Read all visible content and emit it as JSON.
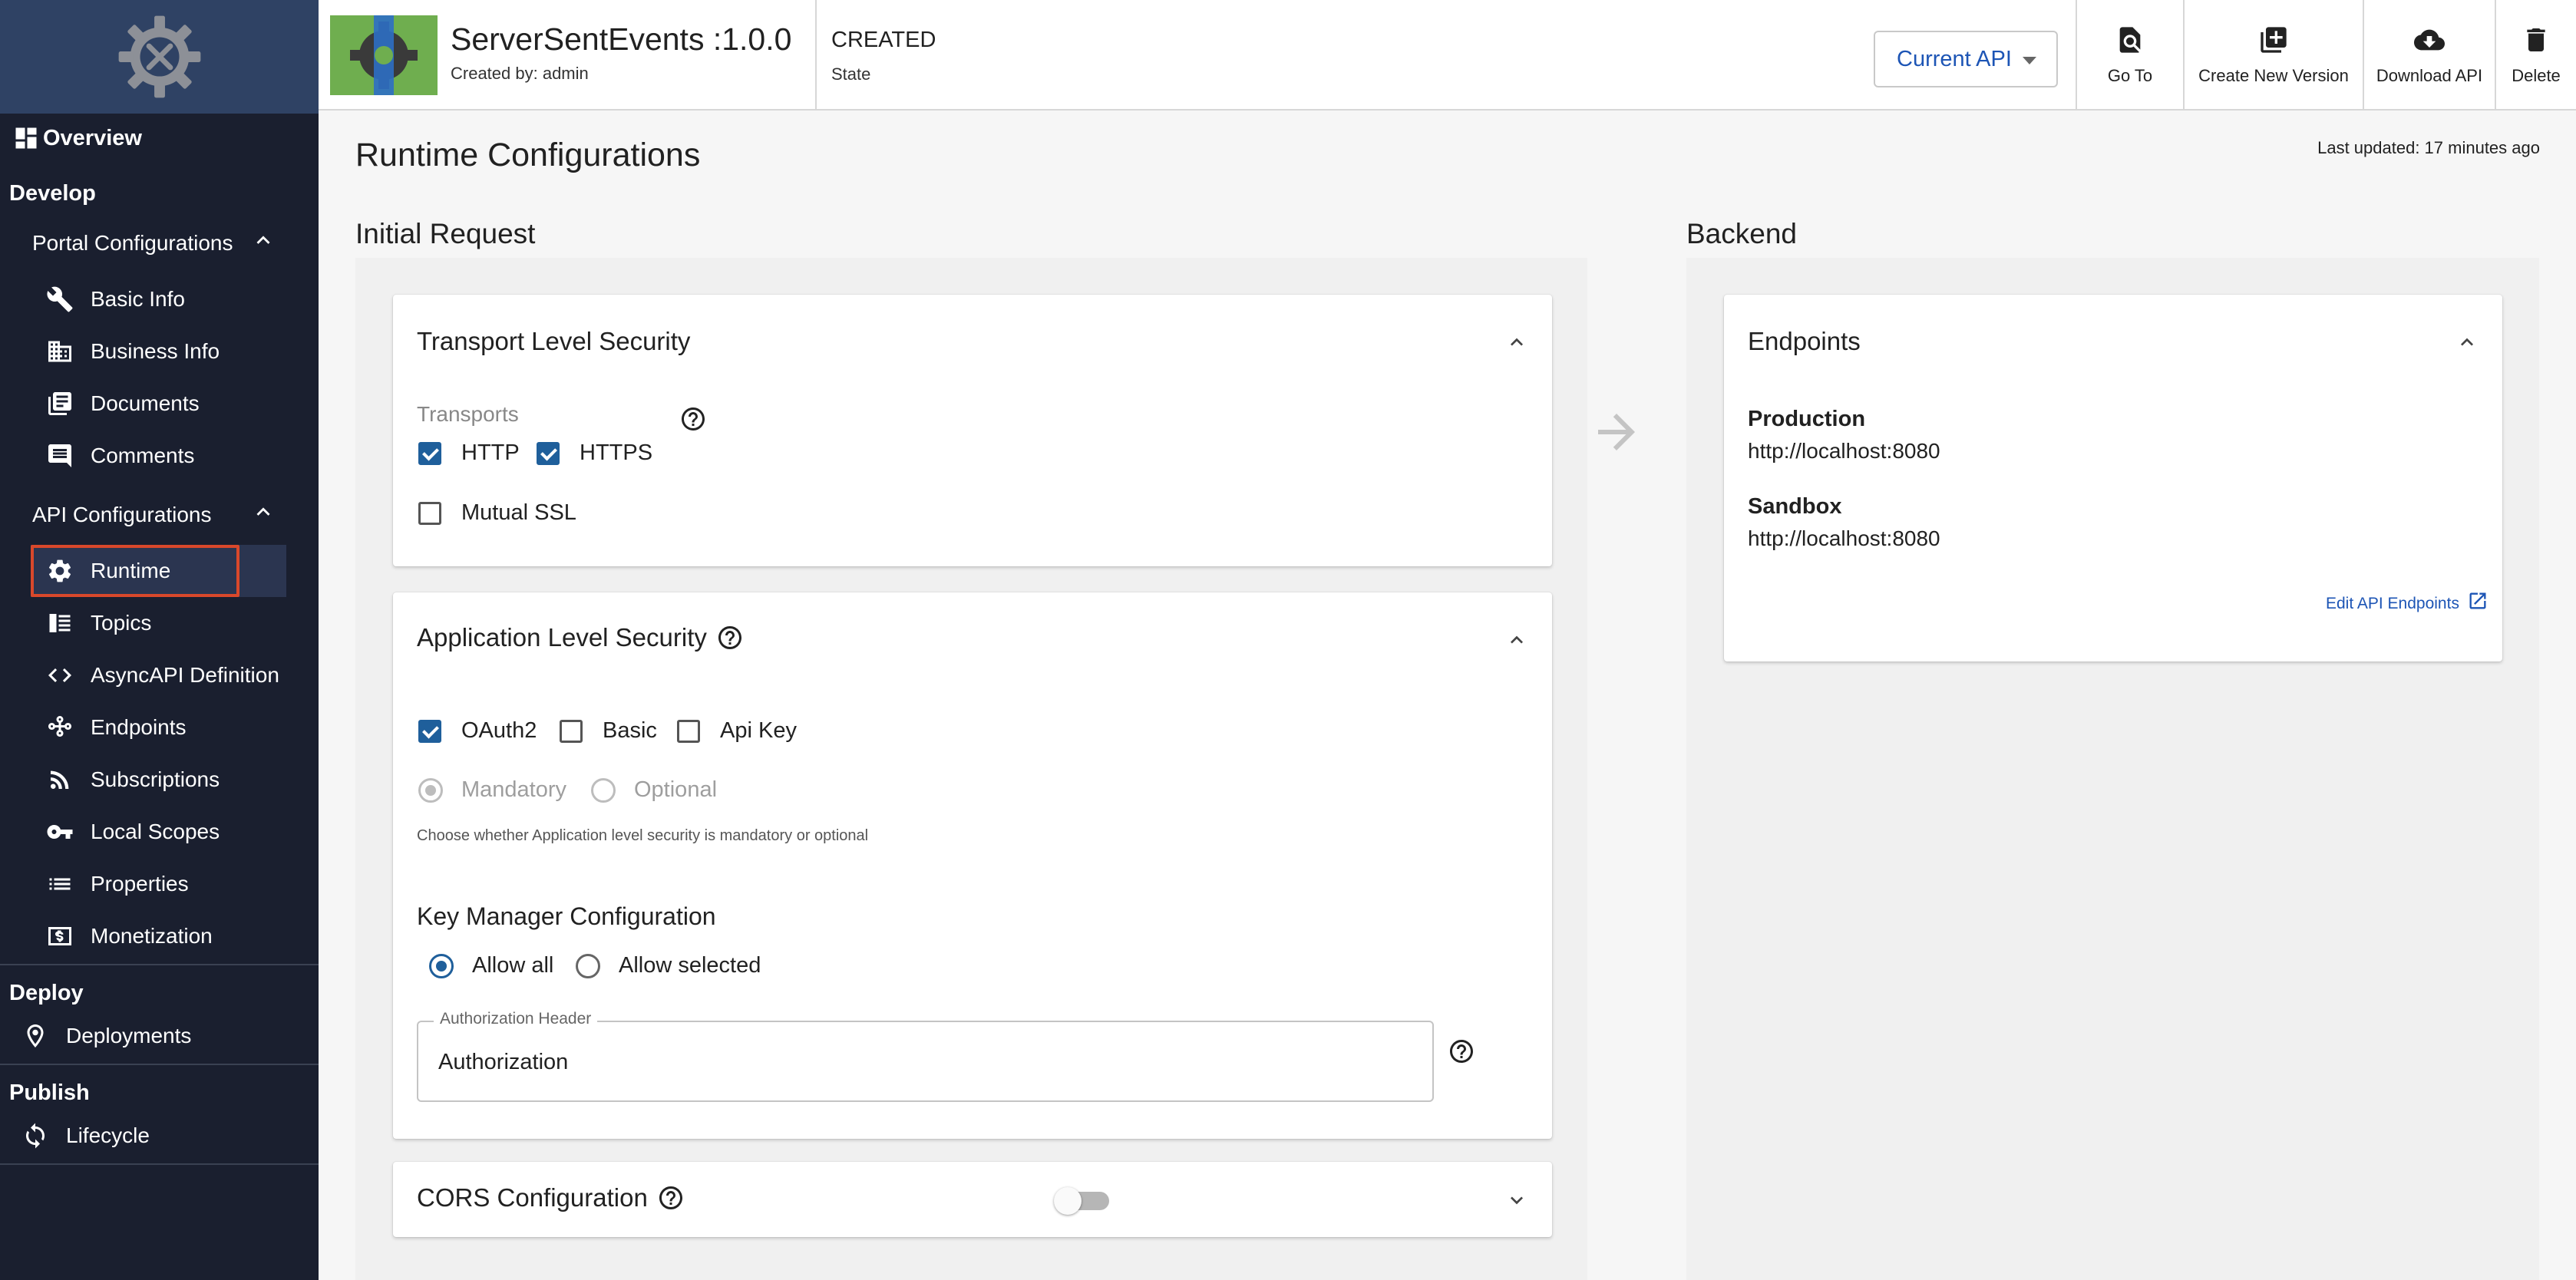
{
  "sidebar": {
    "overview": "Overview",
    "develop": "Develop",
    "portal_configurations": "Portal Configurations",
    "portal_items": [
      "Basic Info",
      "Business Info",
      "Documents",
      "Comments"
    ],
    "api_configurations": "API Configurations",
    "api_items": [
      "Runtime",
      "Topics",
      "AsyncAPI Definition",
      "Endpoints",
      "Subscriptions",
      "Local Scopes",
      "Properties",
      "Monetization"
    ],
    "deploy": "Deploy",
    "deployments": "Deployments",
    "publish": "Publish",
    "lifecycle": "Lifecycle"
  },
  "header": {
    "api_title": "ServerSentEvents :1.0.0",
    "created_by": "Created by: admin",
    "state_value": "CREATED",
    "state_label": "State",
    "current_api": "Current API",
    "go_to": "Go To",
    "create_new_version": "Create New Version",
    "download_api": "Download API",
    "delete": "Delete"
  },
  "main": {
    "page_title": "Runtime Configurations",
    "last_updated": "Last updated: 17 minutes ago",
    "initial_request": "Initial Request",
    "backend": "Backend",
    "transport": {
      "title": "Transport Level Security",
      "transports_label": "Transports",
      "http": "HTTP",
      "https": "HTTPS",
      "mutual_ssl": "Mutual SSL",
      "http_checked": true,
      "https_checked": true,
      "mutual_ssl_checked": false
    },
    "app_security": {
      "title": "Application Level Security",
      "oauth2": "OAuth2",
      "basic": "Basic",
      "api_key": "Api Key",
      "oauth2_checked": true,
      "basic_checked": false,
      "api_key_checked": false,
      "mandatory": "Mandatory",
      "optional": "Optional",
      "hint": "Choose whether Application level security is mandatory or optional",
      "key_manager_title": "Key Manager Configuration",
      "allow_all": "Allow all",
      "allow_selected": "Allow selected",
      "auth_header_label": "Authorization Header",
      "auth_header_value": "Authorization"
    },
    "cors": {
      "title": "CORS Configuration",
      "enabled": false
    },
    "endpoints": {
      "title": "Endpoints",
      "production_label": "Production",
      "production_url": "http://localhost:8080",
      "sandbox_label": "Sandbox",
      "sandbox_url": "http://localhost:8080",
      "edit_link": "Edit API Endpoints"
    }
  },
  "colors": {
    "sidebar_bg": "#1a1f2f",
    "logo_bg": "#2f4264",
    "accent_blue": "#1f5f9b",
    "link_blue": "#1d55b5",
    "highlight_red": "#d9482b"
  }
}
